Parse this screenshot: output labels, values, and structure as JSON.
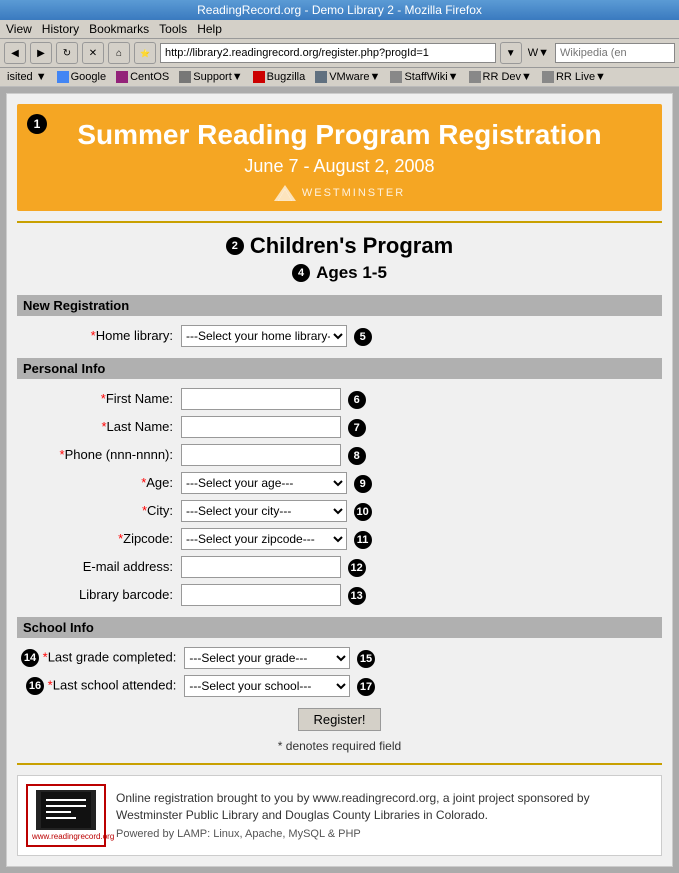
{
  "browser": {
    "title": "ReadingRecord.org - Demo Library 2 - Mozilla Firefox",
    "url": "http://library2.readingrecord.org/register.php?progId=1",
    "menu": [
      "View",
      "History",
      "Bookmarks",
      "Tools",
      "Help"
    ],
    "search_placeholder": "Wikipedia (en",
    "bookmarks": [
      "isited ▼",
      "Google",
      "CentOS",
      "Support▼",
      "Bugzilla",
      "VMware▼",
      "StaffWiki▼",
      "RR Dev▼",
      "RR Live▼"
    ]
  },
  "banner": {
    "badge": "1",
    "title": "Summer Reading Program Registration",
    "subtitle": "June 7 - August 2, 2008",
    "logo_text": "WESTMINSTER"
  },
  "program": {
    "badge": "2",
    "title": "Children's Program",
    "ages_badge": "4",
    "ages": "Ages 1-5"
  },
  "new_registration": {
    "section_label": "New Registration",
    "home_library_label": "*Home library:",
    "home_library_placeholder": "---Select your home library---",
    "home_library_badge": "5"
  },
  "personal_info": {
    "section_label": "Personal Info",
    "fields": [
      {
        "label": "*First Name:",
        "type": "input",
        "badge": "6"
      },
      {
        "label": "*Last Name:",
        "type": "input",
        "badge": "7"
      },
      {
        "label": "*Phone (nnn-nnnn):",
        "type": "input",
        "badge": "8"
      },
      {
        "label": "*Age:",
        "type": "select",
        "placeholder": "---Select your age---",
        "badge": "9"
      },
      {
        "label": "*City:",
        "type": "select",
        "placeholder": "---Select your city---",
        "badge": "10"
      },
      {
        "label": "*Zipcode:",
        "type": "select",
        "placeholder": "---Select your zipcode---",
        "badge": "11"
      },
      {
        "label": "E-mail address:",
        "type": "input",
        "badge": "12"
      },
      {
        "label": "Library barcode:",
        "type": "input",
        "badge": "13"
      }
    ]
  },
  "school_info": {
    "section_label": "School Info",
    "last_grade_label": "*Last grade completed:",
    "last_grade_placeholder": "---Select your grade---",
    "last_grade_badge_left": "14",
    "last_grade_badge_right": "15",
    "last_school_label": "*Last school attended:",
    "last_school_placeholder": "---Select your school---",
    "last_school_badge_left": "16",
    "last_school_badge_right": "17"
  },
  "form": {
    "register_button": "Register!",
    "required_note": "* denotes required field"
  },
  "footer": {
    "logo_url_text": "www.readingrecord.org",
    "description": "Online registration brought to you by www.readingrecord.org, a joint project sponsored by Westminster Public Library and Douglas County Libraries in Colorado.",
    "powered": "Powered by LAMP:  Linux, Apache, MySQL & PHP"
  }
}
